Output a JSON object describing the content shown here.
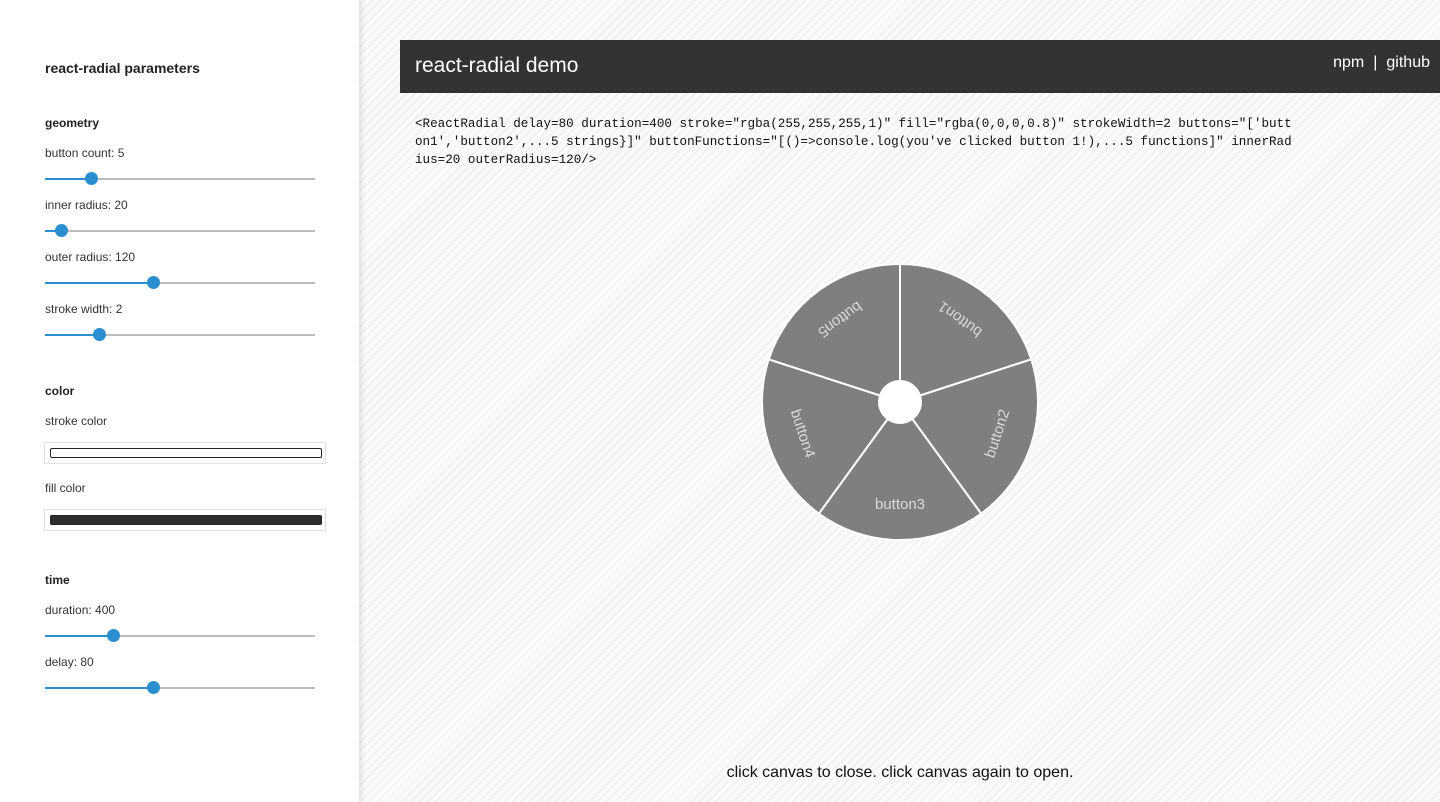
{
  "sidebar": {
    "title": "react-radial parameters",
    "geometry": {
      "heading": "geometry",
      "button_count": {
        "label": "button count: 5",
        "value": 5,
        "fraction": 0.17
      },
      "inner_radius": {
        "label": "inner radius: 20",
        "value": 20,
        "fraction": 0.06
      },
      "outer_radius": {
        "label": "outer radius: 120",
        "value": 120,
        "fraction": 0.4
      },
      "stroke_width": {
        "label": "stroke width: 2",
        "value": 2,
        "fraction": 0.2
      }
    },
    "color": {
      "heading": "color",
      "stroke": {
        "label": "stroke color",
        "value": "#ffffff"
      },
      "fill": {
        "label": "fill color",
        "value": "#2c2c2c"
      }
    },
    "time": {
      "heading": "time",
      "duration": {
        "label": "duration: 400",
        "value": 400,
        "fraction": 0.25
      },
      "delay": {
        "label": "delay: 80",
        "value": 80,
        "fraction": 0.4
      }
    }
  },
  "header": {
    "title": "react-radial demo",
    "npm": "npm",
    "separator": "|",
    "github": "github"
  },
  "code": "<ReactRadial delay=80 duration=400 stroke=\"rgba(255,255,255,1)\" fill=\"rgba(0,0,0,0.8)\" strokeWidth=2 buttons=\"['button1','button2',...5 strings}]\" buttonFunctions=\"[()=>console.log(you've clicked button 1!),...5 functions]\" innerRadius=20 outerRadius=120/>",
  "radial": {
    "buttons": [
      "button1",
      "button2",
      "button3",
      "button4",
      "button5"
    ],
    "fill_color": "#7f7f7f",
    "stroke_color": "#ffffff",
    "text_color": "#d8d8d8"
  },
  "hint": "click canvas to close. click canvas again to open."
}
